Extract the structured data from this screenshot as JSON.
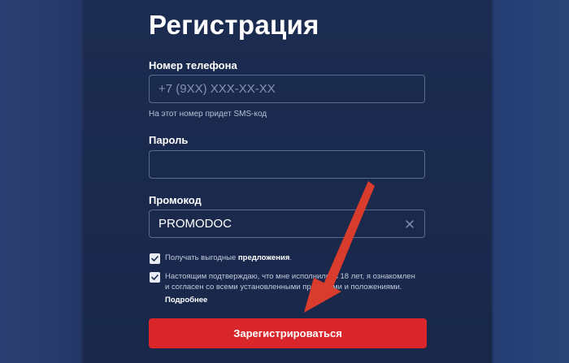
{
  "form": {
    "title": "Регистрация",
    "phone": {
      "label": "Номер телефона",
      "placeholder": "+7 (9XX) XXX-XX-XX",
      "value": "",
      "hint": "На этот номер придет SMS-код"
    },
    "password": {
      "label": "Пароль",
      "value": ""
    },
    "promo": {
      "label": "Промокод",
      "value": "PROMODOC"
    },
    "consent_offers": {
      "checked": true,
      "text": "Получать выгодные ",
      "bold": "предложения",
      "suffix": "."
    },
    "consent_terms": {
      "checked": true,
      "line1": "Настоящим подтверждаю, что мне исполнилось 18 лет, я ознакомлен",
      "line2": "и согласен со всеми установленными правилами и положениями."
    },
    "more_link": "Подробнее",
    "submit_label": "Зарегистрироваться"
  },
  "annotation": {
    "arrow_color": "#d93c2c"
  },
  "colors": {
    "accent": "#d8262b",
    "panel": "#1a2a4e"
  }
}
